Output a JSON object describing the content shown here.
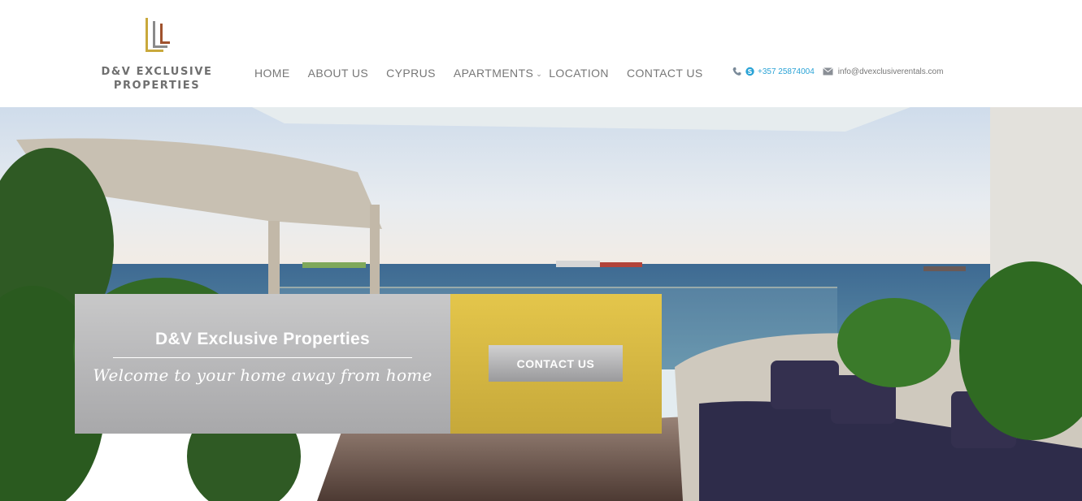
{
  "brand": {
    "line1": "D&V EXCLUSIVE",
    "line2": "PROPERTIES",
    "logo_icon": "dv-logo-icon",
    "colors": {
      "gold": "#c9a93c",
      "brown": "#7b4a2e",
      "grey": "#8a8a8a"
    }
  },
  "nav": {
    "items": [
      {
        "label": "HOME"
      },
      {
        "label": "ABOUT US"
      },
      {
        "label": "CYPRUS"
      },
      {
        "label": "APARTMENTS"
      },
      {
        "label": "LOCATION"
      },
      {
        "label": "CONTACT US"
      }
    ],
    "apartments_chevron": "chevron-down-icon"
  },
  "contact": {
    "phone": "+357 25874004",
    "email": "info@dvexclusiverentals.com",
    "phone_icon": "phone-icon",
    "skype_icon": "skype-icon",
    "email_icon": "envelope-icon"
  },
  "hero": {
    "title": "D&V Exclusive Properties",
    "tagline": "Welcome to your home away from home",
    "cta_label": "CONTACT US",
    "colors": {
      "grey_panel": "#b5b5b7",
      "gold_panel": "#d6b842",
      "link": "#2aa3d6"
    }
  }
}
